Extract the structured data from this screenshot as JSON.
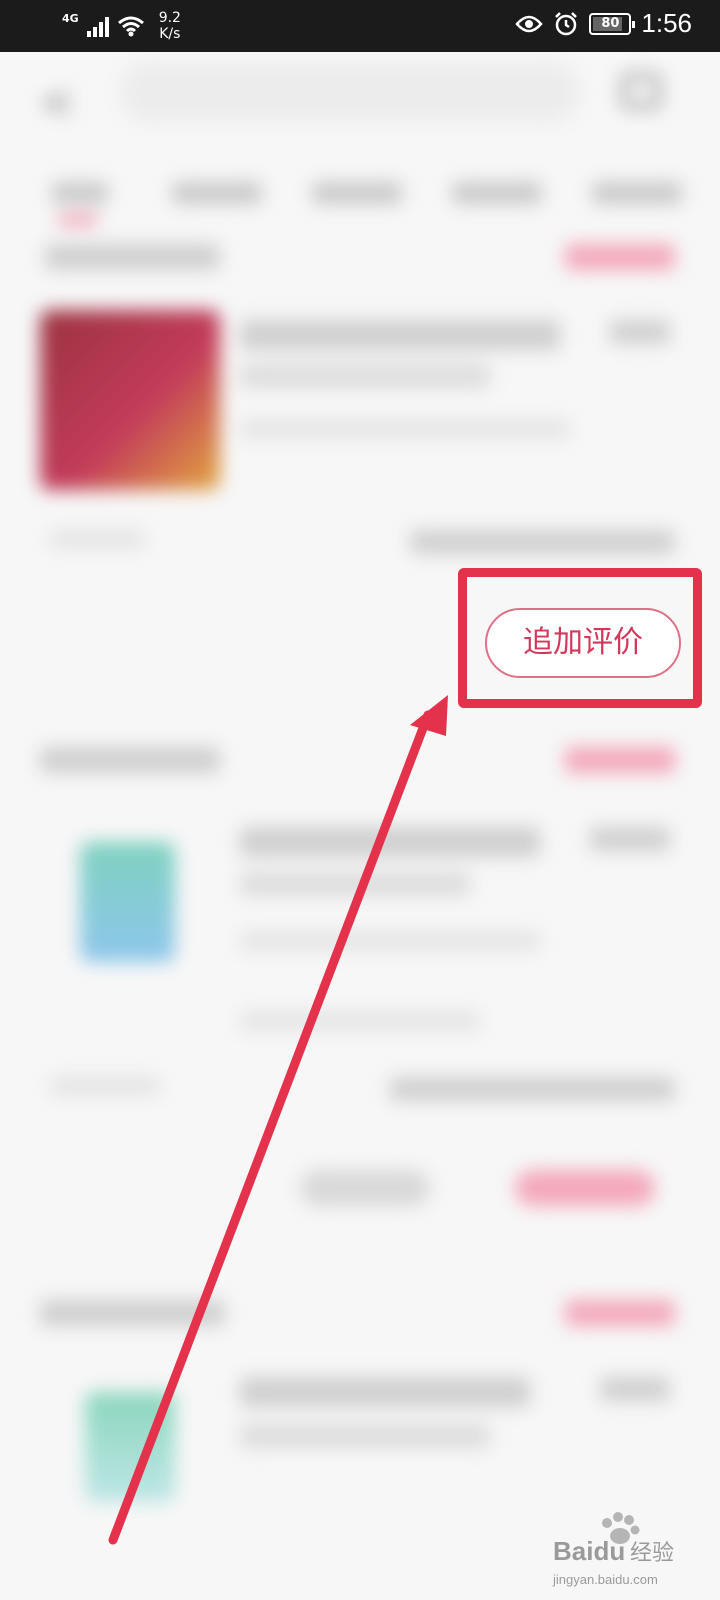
{
  "status_bar": {
    "network": "4G",
    "speed_value": "9.2",
    "speed_unit": "K/s",
    "battery": "80",
    "time": "1:56",
    "icons": [
      "signal-icon",
      "wifi-icon",
      "eye-icon",
      "alarm-icon",
      "battery-icon"
    ]
  },
  "order": {
    "add_review_label": "追加评价"
  },
  "annotation": {
    "highlight_color": "#e4324c"
  },
  "watermark": {
    "brand_latin": "Baidu",
    "brand_cn": "经验",
    "url": "jingyan.baidu.com"
  },
  "colors": {
    "accent": "#d2385a"
  }
}
